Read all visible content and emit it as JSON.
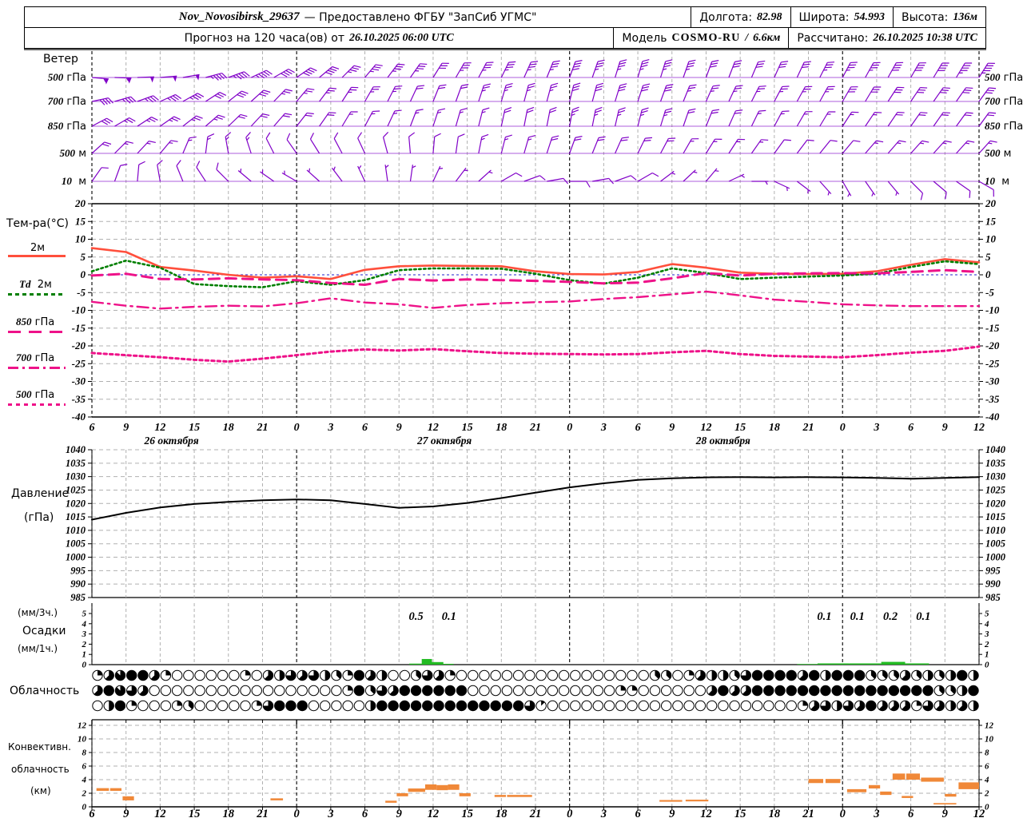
{
  "header": {
    "station": "Nov_Novosibirsk_29637",
    "provider": "— Предоставлено ФГБУ \"ЗапСиб УГМС\"",
    "lon_label": "Долгота:",
    "lon": "82.98",
    "lat_label": "Широта:",
    "lat": "54.993",
    "alt_label": "Высота:",
    "alt": "136м",
    "forecast_label": "Прогноз на 120 часа(ов) от",
    "run_time": "26.10.2025 06:00 UTC",
    "model_label": "Модель",
    "model_name": "COSMO-RU",
    "model_sep": "/",
    "model_res": "6.6км",
    "calc_label": "Рассчитано:",
    "calc_time": "26.10.2025 10:38 UTC"
  },
  "colors": {
    "barb": "#8000c8",
    "t2m": "#ff4f3c",
    "td": "#007f00",
    "pink": "#ee1289",
    "pressure": "#000000",
    "precip": "#22bb22",
    "conv": "#f08838",
    "grid": "#b0b0b0",
    "zero": "#2222cc"
  },
  "axis": {
    "hour_start": 6,
    "hour_span": 78,
    "label_step": 3,
    "x_labels": [
      "6",
      "9",
      "12",
      "15",
      "18",
      "21",
      "0",
      "3",
      "6",
      "9",
      "12",
      "15",
      "18",
      "21",
      "0",
      "3",
      "6",
      "9",
      "12",
      "15",
      "18",
      "21",
      "0",
      "3",
      "6",
      "9",
      "12"
    ],
    "dates": [
      {
        "label": "26 октября",
        "hour": 13
      },
      {
        "label": "27 октября",
        "hour": 37
      },
      {
        "label": "28 октября",
        "hour": 61.5
      }
    ]
  },
  "panels": {
    "wind_title": "Ветер",
    "temp_title": "Тем-ра(°C)",
    "temp_legend": [
      {
        "pre": "",
        "v": "2м"
      },
      {
        "pre": "Td",
        "v": "2м"
      },
      {
        "pre": "850",
        "v": "гПа"
      },
      {
        "pre": "700",
        "v": "гПа"
      },
      {
        "pre": "500",
        "v": "гПа"
      }
    ],
    "pressure_title_1": "Давление",
    "pressure_title_2": "(гПа)",
    "precip_title_1": "(мм/3ч.)",
    "precip_title_2": "Осадки",
    "precip_title_3": "(мм/1ч.)",
    "cloud_title": "Облачность",
    "conv_title_1": "Конвективн.",
    "conv_title_2": "облачность",
    "conv_title_3": "(км)"
  },
  "chart_data": [
    {
      "id": "wind",
      "type": "barbs",
      "title": "Ветер",
      "levels": [
        {
          "v": "500",
          "u": "гПа"
        },
        {
          "v": "700",
          "u": "гПа"
        },
        {
          "v": "850",
          "u": "гПа"
        },
        {
          "v": "500",
          "u": "м"
        },
        {
          "v": "10",
          "u": "м"
        }
      ],
      "key_hours": [
        6,
        12,
        18,
        24,
        30,
        36,
        42,
        48,
        54,
        60,
        66,
        72,
        78,
        84
      ],
      "dirs": [
        [
          95,
          85,
          70,
          55,
          40,
          32,
          26,
          20,
          16,
          20,
          24,
          28,
          30,
          32
        ],
        [
          78,
          66,
          52,
          40,
          30,
          22,
          16,
          14,
          18,
          24,
          28,
          30,
          34,
          36
        ],
        [
          62,
          55,
          46,
          38,
          28,
          18,
          12,
          10,
          14,
          22,
          28,
          33,
          35,
          36
        ],
        [
          48,
          40,
          350,
          325,
          335,
          5,
          14,
          20,
          26,
          32,
          36,
          40,
          42,
          42
        ],
        [
          35,
          350,
          315,
          300,
          335,
          25,
          60,
          90,
          60,
          40,
          115,
          150,
          135,
          120
        ]
      ],
      "speeds": [
        [
          55,
          50,
          45,
          40,
          35,
          32,
          34,
          38,
          36,
          32,
          30,
          34,
          40,
          44
        ],
        [
          38,
          35,
          30,
          26,
          24,
          20,
          24,
          28,
          30,
          26,
          24,
          28,
          30,
          32
        ],
        [
          28,
          25,
          22,
          20,
          16,
          14,
          18,
          24,
          24,
          20,
          16,
          16,
          20,
          22
        ],
        [
          18,
          15,
          14,
          10,
          10,
          10,
          14,
          20,
          20,
          15,
          12,
          12,
          16,
          16
        ],
        [
          8,
          10,
          8,
          5,
          5,
          6,
          8,
          10,
          8,
          6,
          5,
          5,
          8,
          8
        ]
      ]
    },
    {
      "id": "temperature",
      "type": "line",
      "title": "Тем-ра(°C)",
      "ylim": [
        -40,
        20
      ],
      "ytick_step": 5,
      "x_hours": [
        6,
        9,
        12,
        15,
        18,
        21,
        24,
        27,
        30,
        33,
        36,
        39,
        42,
        45,
        48,
        51,
        54,
        57,
        60,
        63,
        66,
        69,
        72,
        75,
        78,
        81,
        84
      ],
      "series": [
        {
          "name": "2м",
          "style": "solid",
          "color": "#ff4f3c",
          "values": [
            7.5,
            6.4,
            2.2,
            1.2,
            0.0,
            -0.8,
            -0.4,
            -1.2,
            1.4,
            2.4,
            2.6,
            2.5,
            2.4,
            1.0,
            0.2,
            0.1,
            0.8,
            3.0,
            2.0,
            0.6,
            0.3,
            0.2,
            0.3,
            1.0,
            2.8,
            4.4,
            3.5
          ]
        },
        {
          "name": "Td 2м",
          "style": "dotted",
          "color": "#007f00",
          "values": [
            1.0,
            4.0,
            2.0,
            -2.6,
            -3.2,
            -3.5,
            -1.8,
            -2.8,
            -1.5,
            1.3,
            1.8,
            1.8,
            1.7,
            0.3,
            -1.5,
            -2.5,
            -0.8,
            1.8,
            0.5,
            -1.2,
            -0.8,
            -0.5,
            -0.2,
            0.3,
            2.2,
            3.8,
            3.0
          ]
        },
        {
          "name": "850 гПа",
          "style": "longdash",
          "color": "#ee1289",
          "values": [
            -0.2,
            0.3,
            -1.2,
            -1.3,
            -1.0,
            -1.3,
            -1.5,
            -2.3,
            -2.8,
            -1.2,
            -1.6,
            -1.3,
            -1.5,
            -1.7,
            -2.0,
            -2.4,
            -2.2,
            -1.0,
            0.5,
            -0.2,
            0.3,
            0.4,
            0.5,
            0.4,
            0.8,
            1.3,
            0.8
          ]
        },
        {
          "name": "700 гПа",
          "style": "dashdot",
          "color": "#ee1289",
          "values": [
            -7.6,
            -8.7,
            -9.5,
            -9.0,
            -8.7,
            -8.9,
            -8.0,
            -6.6,
            -7.8,
            -8.3,
            -9.3,
            -8.5,
            -8.0,
            -7.7,
            -7.5,
            -6.8,
            -6.3,
            -5.5,
            -4.7,
            -5.8,
            -7.0,
            -7.6,
            -8.3,
            -8.6,
            -8.8,
            -8.8,
            -8.8
          ]
        },
        {
          "name": "500 гПа",
          "style": "shortdash",
          "color": "#ee1289",
          "values": [
            -22.0,
            -22.6,
            -23.2,
            -23.9,
            -24.4,
            -23.6,
            -22.6,
            -21.6,
            -21.0,
            -21.3,
            -20.9,
            -21.5,
            -22.0,
            -22.2,
            -22.3,
            -22.4,
            -22.3,
            -21.8,
            -21.4,
            -22.3,
            -22.8,
            -23.0,
            -23.2,
            -22.6,
            -21.9,
            -21.4,
            -20.2
          ]
        }
      ]
    },
    {
      "id": "pressure",
      "type": "line",
      "title": "Давление (гПа)",
      "ylim": [
        985,
        1040
      ],
      "ytick_step": 5,
      "x_hours": [
        6,
        9,
        12,
        15,
        18,
        21,
        24,
        27,
        30,
        33,
        36,
        39,
        42,
        45,
        48,
        51,
        54,
        57,
        60,
        63,
        66,
        69,
        72,
        75,
        78,
        81,
        84
      ],
      "values": [
        1014.0,
        1016.5,
        1018.5,
        1019.8,
        1020.6,
        1021.2,
        1021.5,
        1021.2,
        1019.8,
        1018.4,
        1018.9,
        1020.2,
        1022.0,
        1024.0,
        1026.0,
        1027.5,
        1028.8,
        1029.4,
        1029.7,
        1029.8,
        1029.7,
        1029.8,
        1029.7,
        1029.5,
        1029.2,
        1029.5,
        1029.8
      ]
    },
    {
      "id": "precip",
      "type": "bar",
      "title": "Осадки (мм/3ч.) (мм/1ч.)",
      "ylim": [
        0,
        6
      ],
      "yticks": [
        0,
        1,
        2,
        3,
        4,
        5
      ],
      "bars": [
        [
          33.9,
          35.0,
          0.1
        ],
        [
          35.0,
          35.9,
          0.55
        ],
        [
          35.9,
          36.9,
          0.25
        ],
        [
          36.9,
          37.8,
          0.08
        ],
        [
          68.0,
          69.8,
          0.06
        ],
        [
          69.8,
          72.6,
          0.12
        ],
        [
          72.6,
          75.4,
          0.12
        ],
        [
          75.4,
          77.5,
          0.27
        ],
        [
          77.5,
          79.6,
          0.12
        ]
      ],
      "annotations": [
        {
          "hour": 34.5,
          "label": "0.5"
        },
        {
          "hour": 37.4,
          "label": "0.1"
        },
        {
          "hour": 70.4,
          "label": "0.1"
        },
        {
          "hour": 73.3,
          "label": "0.1"
        },
        {
          "hour": 76.2,
          "label": "0.2"
        },
        {
          "hour": 79.1,
          "label": "0.1"
        }
      ]
    },
    {
      "id": "cloud",
      "type": "heatmap",
      "title": "Облачность",
      "scale": "eighths 0-8 per circle, hourly",
      "rows": [
        "257885200000020546564328540036520000000000000000033025443688885848883335343484",
        "587650000000000000000028365888888000000000000022000000585588888888888888883348",
        "048200023000002688800000488888888888886100000000000000000000002564658555265454"
      ]
    },
    {
      "id": "convective",
      "type": "bar",
      "title": "Конвективная облачность (км)",
      "ylim": [
        0,
        12
      ],
      "ytick_step": 2,
      "bars": [
        [
          6.4,
          7.5,
          2.35,
          2.75
        ],
        [
          7.6,
          8.6,
          2.35,
          2.75
        ],
        [
          8.7,
          9.7,
          0.95,
          1.55
        ],
        [
          21.7,
          22.8,
          0.95,
          1.25
        ],
        [
          31.8,
          32.8,
          0.6,
          0.9
        ],
        [
          32.8,
          33.8,
          1.55,
          2.0
        ],
        [
          33.8,
          35.3,
          2.2,
          2.7
        ],
        [
          35.3,
          36.3,
          2.5,
          3.3
        ],
        [
          36.3,
          37.3,
          2.45,
          3.2
        ],
        [
          37.3,
          38.3,
          2.5,
          3.3
        ],
        [
          38.3,
          39.3,
          1.55,
          2.0
        ],
        [
          41.4,
          42.4,
          1.45,
          1.75
        ],
        [
          42.5,
          44.7,
          1.45,
          1.75
        ],
        [
          55.9,
          57.9,
          0.75,
          1.0
        ],
        [
          58.2,
          60.2,
          0.8,
          1.05
        ],
        [
          69.0,
          70.3,
          3.5,
          4.1
        ],
        [
          70.5,
          71.8,
          3.5,
          4.1
        ],
        [
          72.4,
          74.1,
          2.15,
          2.6
        ],
        [
          74.3,
          75.3,
          2.7,
          3.2
        ],
        [
          75.3,
          76.3,
          1.75,
          2.25
        ],
        [
          76.4,
          77.5,
          4.0,
          4.9
        ],
        [
          77.6,
          78.8,
          4.0,
          4.9
        ],
        [
          78.9,
          80.9,
          3.7,
          4.3
        ],
        [
          77.2,
          78.2,
          1.3,
          1.6
        ],
        [
          81.0,
          82.0,
          1.5,
          1.9
        ],
        [
          82.2,
          84.0,
          2.6,
          3.6
        ],
        [
          80.0,
          82.0,
          0.35,
          0.55
        ]
      ]
    }
  ]
}
